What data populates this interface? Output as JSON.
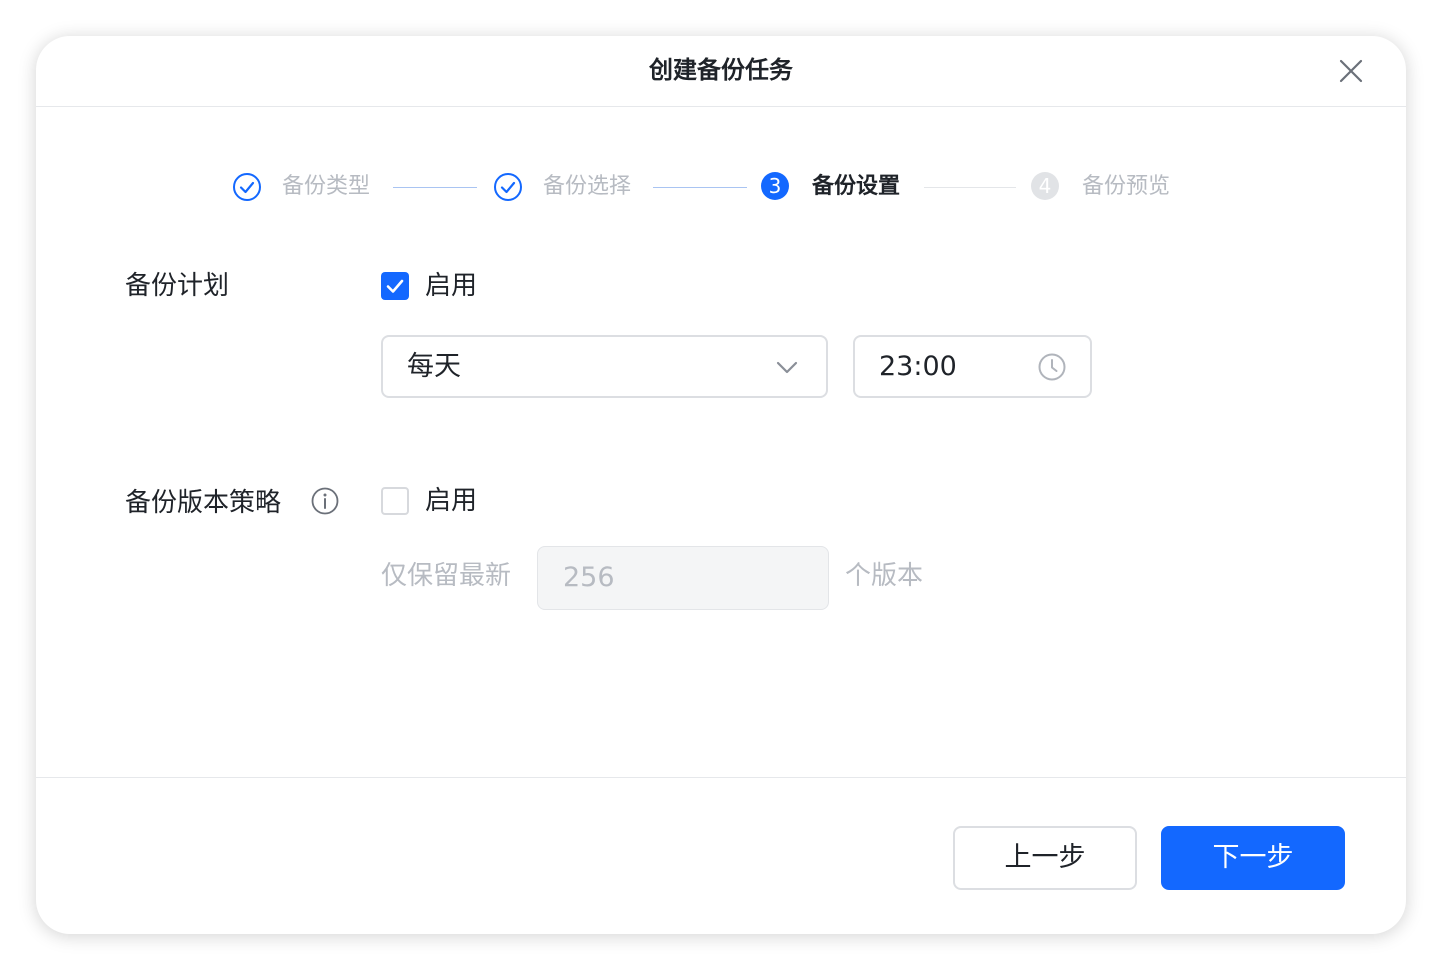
{
  "dialog": {
    "title": "创建备份任务"
  },
  "steps": [
    {
      "label": "备份类型",
      "state": "done"
    },
    {
      "label": "备份选择",
      "state": "done"
    },
    {
      "label": "备份设置",
      "state": "active",
      "number": "3"
    },
    {
      "label": "备份预览",
      "state": "todo",
      "number": "4"
    }
  ],
  "schedule": {
    "label": "备份计划",
    "enable_label": "启用",
    "enabled": true,
    "frequency": "每天",
    "time": "23:00"
  },
  "versioning": {
    "label": "备份版本策略",
    "enable_label": "启用",
    "enabled": false,
    "keep_prefix": "仅保留最新",
    "keep_count": "256",
    "keep_suffix": "个版本"
  },
  "footer": {
    "prev_label": "上一步",
    "next_label": "下一步"
  },
  "colors": {
    "accent": "#1368ff",
    "text_primary": "#1f2329",
    "text_muted": "#b7bbc2"
  }
}
